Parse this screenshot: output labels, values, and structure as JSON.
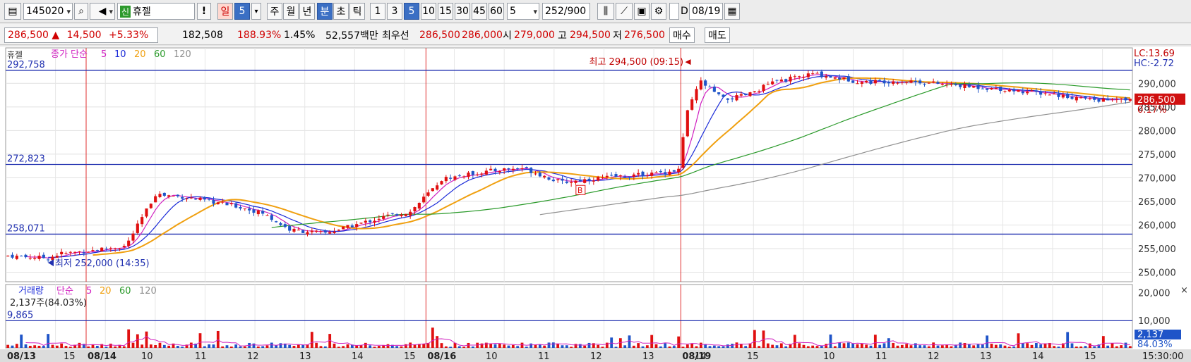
{
  "toolbar": {
    "code": "145020",
    "name_tag": "신",
    "name": "휴젤",
    "periods": [
      "일",
      "5",
      "주",
      "월",
      "년",
      "분",
      "초",
      "틱"
    ],
    "minutes": [
      "1",
      "3",
      "5",
      "10",
      "15",
      "30",
      "45",
      "60"
    ],
    "count": "5",
    "bars": "252",
    "bars_total": "/900",
    "date_check_label": "D",
    "date": "08/19"
  },
  "quote": {
    "price": "286,500",
    "arrow": "▲",
    "change": "14,500",
    "change_pct": "+5.33%",
    "volume": "182,508",
    "volume_ratio": "188.93%",
    "turnover": "1.45%",
    "amount": "52,557백만",
    "best_label": "최우선",
    "best_ask": "286,500",
    "best_bid": "286,000",
    "open_label": "시",
    "open": "279,000",
    "high_label": "고",
    "high": "294,500",
    "low_label": "저",
    "low": "276,500",
    "buy": "매수",
    "sell": "매도"
  },
  "chart_data": [
    {
      "type": "candlestick",
      "legend": {
        "prefix": "종가 단순",
        "periods": [
          "5",
          "10",
          "20",
          "60",
          "120"
        ]
      },
      "corner_tag": "휴젤",
      "hlines": [
        {
          "label": "292,758",
          "value": 292758
        },
        {
          "label": "272,823",
          "value": 272823
        },
        {
          "label": "258,071",
          "value": 258071
        }
      ],
      "ylim": [
        248000,
        297500
      ],
      "y_ticks": [
        "290,000",
        "285,000",
        "280,000",
        "275,000",
        "270,000",
        "265,000",
        "260,000",
        "255,000",
        "250,000"
      ],
      "right_labels": {
        "lc": "LC:13.69",
        "hc": "HC:-2.72",
        "price": "286,500",
        "pct": "0.17%"
      },
      "annotations": {
        "high": "최고 294,500 (09:15)",
        "low": "최저 252,000 (14:35)",
        "marker": "B"
      },
      "ohlc": []
    },
    {
      "type": "bar",
      "legend": {
        "title": "거래량",
        "ma_label": "단순",
        "periods": [
          "5",
          "20",
          "60",
          "120"
        ]
      },
      "info": "2,137주(84.03%)",
      "hline": {
        "label": "9,865",
        "value": 9865
      },
      "ylim": [
        0,
        23000
      ],
      "y_ticks": [
        "20,000",
        "10,000"
      ],
      "right_labels": {
        "value": "2,137",
        "pct": "84.03%"
      },
      "values": []
    }
  ],
  "xaxis": {
    "labels": [
      "08/13",
      "15",
      "08/14",
      "10",
      "11",
      "12",
      "13",
      "14",
      "15",
      "08/16",
      "10",
      "11",
      "12",
      "13",
      "14",
      "15",
      "08/19",
      "10",
      "11",
      "12",
      "13",
      "14",
      "15"
    ],
    "time": "15:30:00"
  },
  "colors": {
    "up": "#e01010",
    "down": "#1f54c8",
    "ma5": "#d020c0",
    "ma10": "#1a2ad8",
    "ma20": "#f0a010",
    "ma60": "#2a9a2a",
    "ma120": "#909090",
    "hline": "#2030b0",
    "vline": "#e03030"
  }
}
